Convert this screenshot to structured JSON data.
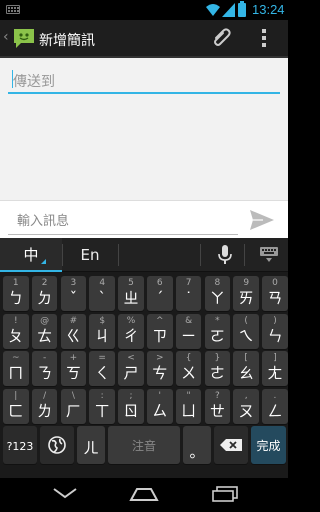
{
  "status_bar": {
    "time": "13:24"
  },
  "action_bar": {
    "title": "新增簡訊"
  },
  "recipient": {
    "placeholder": "傳送到"
  },
  "compose": {
    "placeholder": "輸入訊息"
  },
  "keyboard": {
    "modes": {
      "chinese": "中",
      "english": "En"
    },
    "rows": [
      [
        {
          "main": "ㄅ",
          "hint": "1"
        },
        {
          "main": "ㄉ",
          "hint": "2"
        },
        {
          "main": "ˇ",
          "hint": "3"
        },
        {
          "main": "ˋ",
          "hint": "4"
        },
        {
          "main": "ㄓ",
          "hint": "5"
        },
        {
          "main": "ˊ",
          "hint": "6"
        },
        {
          "main": "˙",
          "hint": "7"
        },
        {
          "main": "ㄚ",
          "hint": "8"
        },
        {
          "main": "ㄞ",
          "hint": "9"
        },
        {
          "main": "ㄢ",
          "hint": "0"
        }
      ],
      [
        {
          "main": "ㄆ",
          "hint": "!"
        },
        {
          "main": "ㄊ",
          "hint": "@"
        },
        {
          "main": "ㄍ",
          "hint": "#"
        },
        {
          "main": "ㄐ",
          "hint": "$"
        },
        {
          "main": "ㄔ",
          "hint": "%"
        },
        {
          "main": "ㄗ",
          "hint": "^"
        },
        {
          "main": "ㄧ",
          "hint": "&"
        },
        {
          "main": "ㄛ",
          "hint": "*"
        },
        {
          "main": "ㄟ",
          "hint": "("
        },
        {
          "main": "ㄣ",
          "hint": ")"
        }
      ],
      [
        {
          "main": "ㄇ",
          "hint": "~"
        },
        {
          "main": "ㄋ",
          "hint": "-"
        },
        {
          "main": "ㄎ",
          "hint": "+"
        },
        {
          "main": "ㄑ",
          "hint": "="
        },
        {
          "main": "ㄕ",
          "hint": "<"
        },
        {
          "main": "ㄘ",
          "hint": ">"
        },
        {
          "main": "ㄨ",
          "hint": "{"
        },
        {
          "main": "ㄜ",
          "hint": "}"
        },
        {
          "main": "ㄠ",
          "hint": "["
        },
        {
          "main": "ㄤ",
          "hint": "]"
        }
      ],
      [
        {
          "main": "ㄈ",
          "hint": "|"
        },
        {
          "main": "ㄌ",
          "hint": "/"
        },
        {
          "main": "ㄏ",
          "hint": "\\"
        },
        {
          "main": "ㄒ",
          "hint": ":"
        },
        {
          "main": "ㄖ",
          "hint": ";"
        },
        {
          "main": "ㄙ",
          "hint": "'"
        },
        {
          "main": "ㄩ",
          "hint": "\""
        },
        {
          "main": "ㄝ",
          "hint": "?"
        },
        {
          "main": "ㄡ",
          "hint": ","
        },
        {
          "main": "ㄥ",
          "hint": "."
        }
      ]
    ],
    "bottom": {
      "sym": "?123",
      "er": "ㄦ",
      "space": "注音",
      "done": "完成",
      "period": "。"
    }
  }
}
